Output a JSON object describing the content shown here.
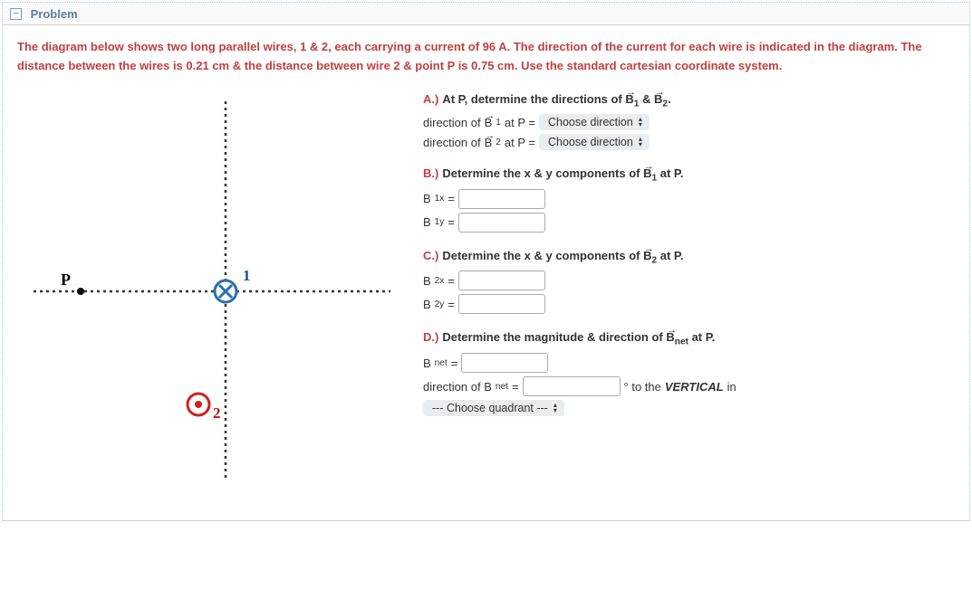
{
  "header": {
    "toggle_glyph": "−",
    "title": "Problem"
  },
  "problem_text": "The diagram below shows two long parallel wires, 1 & 2, each carrying a current of 96 A. The direction of the current for each wire is indicated in the diagram. The distance between the wires is 0.21 cm & the distance between wire 2 & point P is 0.75 cm. Use the standard cartesian coordinate system.",
  "diagram": {
    "label_P": "P",
    "label_wire1": "1",
    "label_wire2": "2"
  },
  "parts": {
    "a": {
      "letter": "A.)",
      "title_prefix": "At P, determine the directions of ",
      "vec1": "B",
      "vec1sub": "1",
      "amp": " & ",
      "vec2": "B",
      "vec2sub": "2",
      "period": ".",
      "row1_prefix": "direction of ",
      "row1_suffix": " at P = ",
      "row2_prefix": "direction of ",
      "row2_suffix": " at P = ",
      "select_placeholder": "Choose direction"
    },
    "b": {
      "letter": "B.)",
      "title_prefix": "Determine the x & y components of ",
      "vec": "B",
      "vecsub": "1",
      "title_suffix": " at P.",
      "r1": "B",
      "r1s": "1x",
      "r2": "B",
      "r2s": "1y",
      "eq": " = "
    },
    "c": {
      "letter": "C.)",
      "title_prefix": "Determine the x & y components of ",
      "vec": "B",
      "vecsub": "2",
      "title_suffix": " at P.",
      "r1": "B",
      "r1s": "2x",
      "r2": "B",
      "r2s": "2y",
      "eq": " = "
    },
    "d": {
      "letter": "D.)",
      "title_prefix": "Determine the magnitude & direction of ",
      "vec": "B",
      "vecsub": "net",
      "title_suffix": " at P.",
      "r1": "B",
      "r1s": "net",
      "eq": " = ",
      "dir_prefix": "direction of B",
      "dir_sub": "net",
      "dir_eq": " = ",
      "dir_suffix1": "° to the ",
      "dir_suffix2": "VERTICAL",
      "dir_suffix3": " in",
      "quad_placeholder": "--- Choose quadrant ---"
    }
  }
}
